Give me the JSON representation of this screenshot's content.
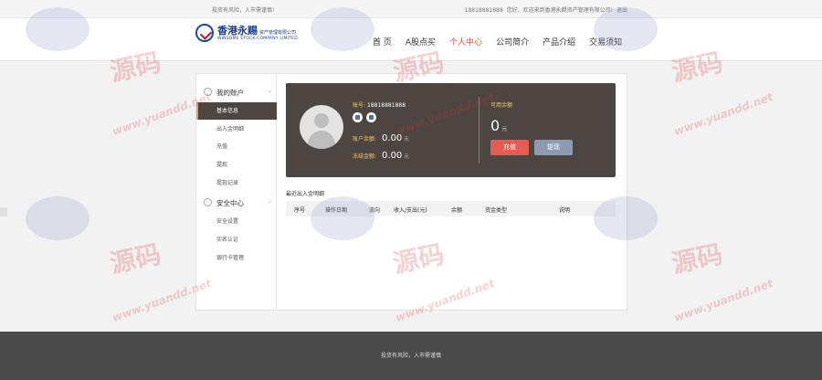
{
  "topbar": {
    "notice": "投资有风险，入市需谨慎!",
    "phone": "18818881888",
    "greeting": "您好,",
    "welcome": "欢迎来到香港永赐资产管理有限公司!",
    "logout": "退出"
  },
  "logo": {
    "cn": "香港永赐",
    "cn_sub": "资产管理有限公司",
    "en": "WINSOME STOCK COMPANY LIMITED"
  },
  "nav": [
    {
      "label": "首 页",
      "active": false
    },
    {
      "label": "A股点买",
      "active": false
    },
    {
      "label": "个人中心",
      "active": true
    },
    {
      "label": "公司简介",
      "active": false
    },
    {
      "label": "产品介绍",
      "active": false
    },
    {
      "label": "交易须知",
      "active": false
    }
  ],
  "sidebar": {
    "account_group": "我的账户",
    "account_items": [
      "基本信息",
      "出入金明细",
      "充值",
      "提现",
      "提现记录"
    ],
    "security_group": "安全中心",
    "security_items": [
      "安全设置",
      "实名认证",
      "银行卡管理"
    ]
  },
  "card": {
    "account_label": "账号:",
    "account_value": "18818881888",
    "balance_label": "账户余额:",
    "balance_value": "0.00",
    "frozen_label": "冻结金额:",
    "frozen_value": "0.00",
    "unit": "元",
    "available_label": "可用余额",
    "available_value": "0",
    "recharge": "充值",
    "withdraw": "提现"
  },
  "detail": {
    "title": "最近出入金明细",
    "columns": [
      "序号",
      "操作日期",
      "流向",
      "收入/支出(元)",
      "余额",
      "资金类型",
      "说明"
    ]
  },
  "footer": {
    "text": "投资有风险，入市需谨慎"
  },
  "colors": {
    "accent": "#e94a36",
    "card_bg": "#4c4541",
    "gold": "#f0c860",
    "footer_bg": "#4a4a4a"
  }
}
